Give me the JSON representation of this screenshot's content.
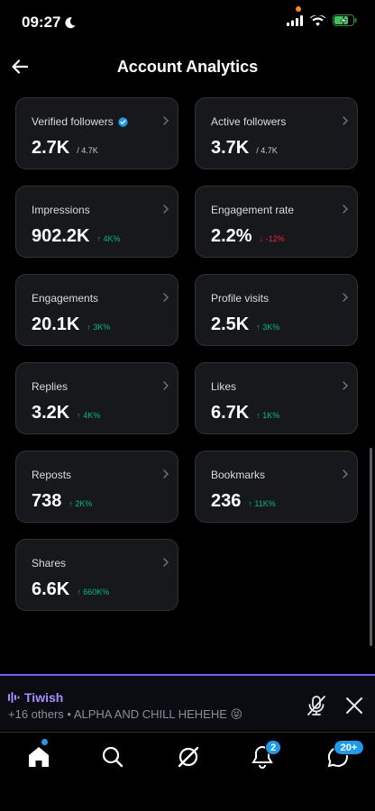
{
  "status": {
    "time": "09:27"
  },
  "header": {
    "title": "Account Analytics"
  },
  "cards": [
    {
      "label": "Verified followers",
      "value": "2.7K",
      "sub": "/ 4.7K",
      "trend": "none",
      "verified": true
    },
    {
      "label": "Active followers",
      "value": "3.7K",
      "sub": "/ 4.7K",
      "trend": "none"
    },
    {
      "label": "Impressions",
      "value": "902.2K",
      "sub": "↑ 4K%",
      "trend": "up"
    },
    {
      "label": "Engagement rate",
      "value": "2.2%",
      "sub": "↓ -12%",
      "trend": "down"
    },
    {
      "label": "Engagements",
      "value": "20.1K",
      "sub": "↑ 3K%",
      "trend": "up"
    },
    {
      "label": "Profile visits",
      "value": "2.5K",
      "sub": "↑ 3K%",
      "trend": "up"
    },
    {
      "label": "Replies",
      "value": "3.2K",
      "sub": "↑ 4K%",
      "trend": "up"
    },
    {
      "label": "Likes",
      "value": "6.7K",
      "sub": "↑ 1K%",
      "trend": "up"
    },
    {
      "label": "Reposts",
      "value": "738",
      "sub": "↑ 2K%",
      "trend": "up"
    },
    {
      "label": "Bookmarks",
      "value": "236",
      "sub": "↑ 11K%",
      "trend": "up"
    },
    {
      "label": "Shares",
      "value": "6.6K",
      "sub": "↑ 660K%",
      "trend": "up"
    }
  ],
  "space": {
    "title": "Tiwish",
    "subtitle": "+16 others • ALPHA AND CHILL HEHEHE 😝"
  },
  "tabs": {
    "notifications_badge": "2",
    "messages_badge": "20+"
  },
  "colors": {
    "accent": "#1d9bf0",
    "up": "#00ba7c",
    "down": "#f4212e",
    "space": "#7856ff"
  }
}
